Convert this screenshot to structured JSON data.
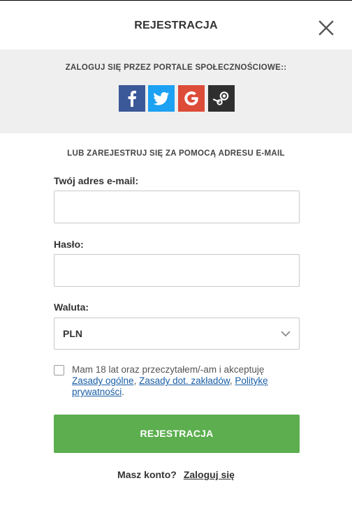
{
  "header": {
    "title": "REJESTRACJA",
    "close_icon": "close-icon"
  },
  "social": {
    "title": "ZALOGUJ SIĘ PRZEZ PORTALE SPOŁECZNOŚCIOWE::",
    "providers": [
      {
        "name": "facebook",
        "icon": "facebook-icon",
        "color": "#3b5998"
      },
      {
        "name": "twitter",
        "icon": "twitter-icon",
        "color": "#1da1f2"
      },
      {
        "name": "google",
        "icon": "google-icon",
        "color": "#dd4b39"
      },
      {
        "name": "steam",
        "icon": "steam-icon",
        "color": "#2f2f2f"
      }
    ]
  },
  "email_section": {
    "title": "LUB ZAREJESTRUJ SIĘ ZA POMOCĄ ADRESU E-MAIL"
  },
  "form": {
    "email_label": "Twój adres e-mail:",
    "email_value": "",
    "password_label": "Hasło:",
    "password_value": "",
    "currency_label": "Waluta:",
    "currency_value": "PLN",
    "consent": {
      "checked": false,
      "text_before": "Mam 18 lat oraz przeczytałem/-am i akceptuję ",
      "link_general": "Zasady ogólne",
      "sep1": ", ",
      "link_bets": "Zasady dot. zakładów",
      "sep2": ", ",
      "link_privacy": "Politykę prywatności",
      "text_after": "."
    },
    "submit_label": "REJESTRACJA"
  },
  "footer": {
    "question": "Masz konto?",
    "login_link": "Zaloguj się"
  },
  "colors": {
    "accent_green": "#5cae4f",
    "link_blue": "#1a5fa6",
    "social_band": "#efefef"
  }
}
